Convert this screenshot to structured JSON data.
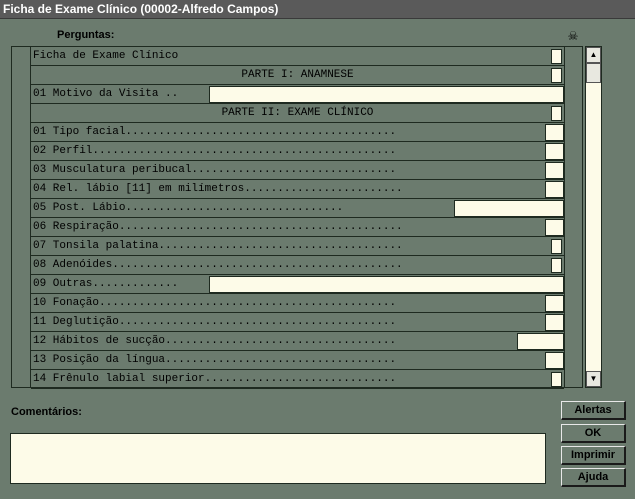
{
  "window": {
    "title": "Ficha de Exame Clínico (00002-Alfredo Campos)"
  },
  "labels": {
    "questions": "Perguntas:",
    "comments": "Comentários:",
    "alert_symbol": "☠"
  },
  "rows": [
    {
      "text": "Ficha de Exame Clínico",
      "kind": "checkbox"
    },
    {
      "text": "PARTE I: ANAMNESE",
      "kind": "heading"
    },
    {
      "text": "01 Motivo da Visita ..",
      "kind": "textfield"
    },
    {
      "text": "PARTE II: EXAME CLÍNICO",
      "kind": "heading"
    },
    {
      "text": "01 Tipo facial.........................................",
      "kind": "field"
    },
    {
      "text": "02 Perfil..............................................",
      "kind": "field"
    },
    {
      "text": "03 Musculatura peribucal...............................",
      "kind": "field"
    },
    {
      "text": "04 Rel. lábio [11] em milímetros........................",
      "kind": "field"
    },
    {
      "text": "05 Post. Lábio.................................",
      "kind": "textfield"
    },
    {
      "text": "06 Respiração...........................................",
      "kind": "field"
    },
    {
      "text": "07 Tonsila palatina.....................................",
      "kind": "field"
    },
    {
      "text": "08 Adenóides............................................",
      "kind": "field"
    },
    {
      "text": "09 Outras.............",
      "kind": "textfield"
    },
    {
      "text": "10 Fonação.............................................",
      "kind": "field"
    },
    {
      "text": "11 Deglutição..........................................",
      "kind": "field"
    },
    {
      "text": "12 Hábitos de sucção...................................",
      "kind": "field"
    },
    {
      "text": "13 Posição da língua...................................",
      "kind": "field"
    },
    {
      "text": "14 Frênulo labial superior.............................",
      "kind": "field"
    }
  ],
  "buttons": {
    "alerts": "Alertas",
    "ok": "OK",
    "print": "Imprimir",
    "help": "Ajuda"
  },
  "colors": {
    "background": "#6b7b6e",
    "field": "#fdfbe8",
    "titlebar": "#5a5a5a"
  }
}
